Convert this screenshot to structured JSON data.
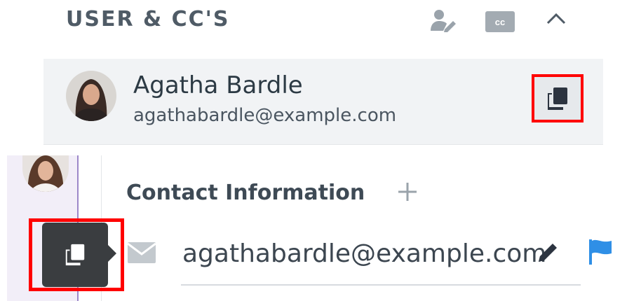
{
  "section": {
    "title": "USER & CC'S",
    "icons": [
      "user-edit-icon",
      "cc-icon",
      "chevron-up-icon"
    ],
    "cc_label": "cc"
  },
  "user": {
    "name": "Agatha Bardle",
    "email": "agathabardle@example.com"
  },
  "contact": {
    "title": "Contact Information",
    "email": "agathabardle@example.com"
  },
  "colors": {
    "highlight": "#ff0000",
    "flag": "#2f8fe6",
    "tooltip_bg": "#3a3d40",
    "row_bg": "#f1f3f5",
    "accent_line": "#9c87c9"
  }
}
